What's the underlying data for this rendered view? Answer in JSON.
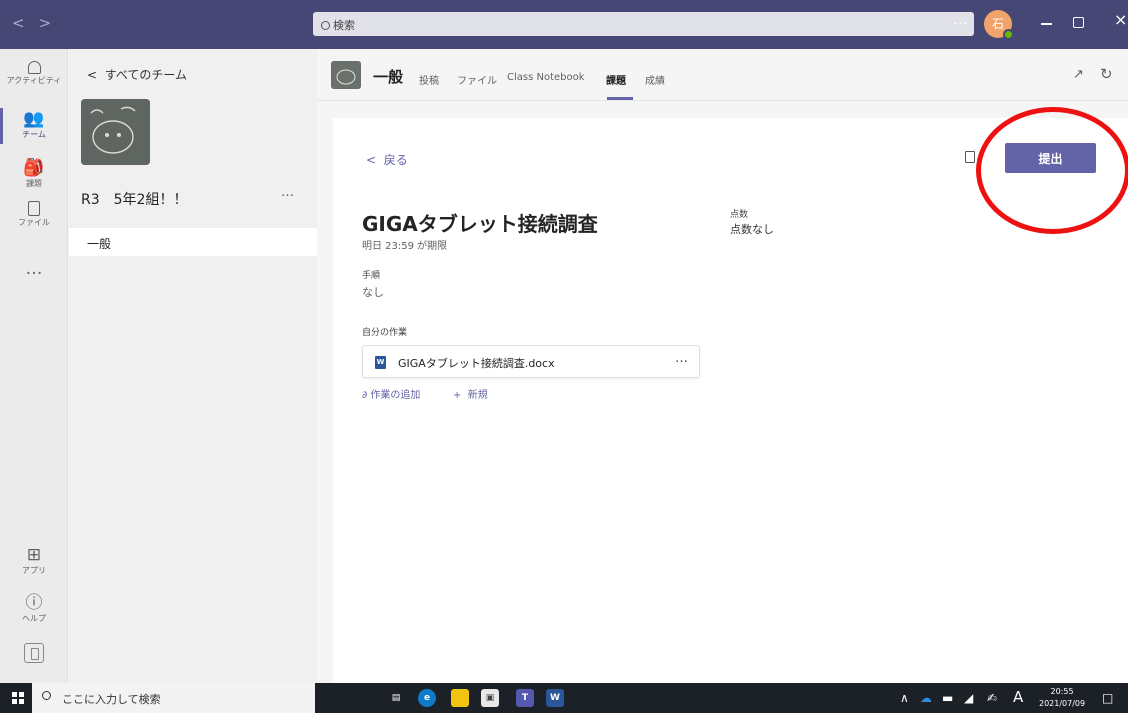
{
  "titlebar": {
    "nav_back": "<",
    "nav_forward": ">",
    "search_placeholder": "検索",
    "more": "…",
    "avatar_initial": "石",
    "minimize": "",
    "maximize": "",
    "close": "×"
  },
  "appbar": {
    "items": [
      {
        "label": "アクティビティ",
        "icon": "bell-icon"
      },
      {
        "label": "チーム",
        "icon": "teams-icon"
      },
      {
        "label": "課題",
        "icon": "assignments-icon"
      },
      {
        "label": "ファイル",
        "icon": "file-icon"
      },
      {
        "label": "…",
        "icon": "more-icon"
      },
      {
        "label": "アプリ",
        "icon": "apps-icon"
      },
      {
        "label": "ヘルプ",
        "icon": "help-icon"
      }
    ],
    "active_index": 1
  },
  "teampanel": {
    "all_teams": "すべてのチーム",
    "team_name": "R3　5年2組！！",
    "team_more": "…",
    "channels": [
      "一般"
    ]
  },
  "channel": {
    "title": "一般",
    "tabs": [
      "投稿",
      "ファイル",
      "Class Notebook",
      "課題",
      "成績"
    ],
    "active_tab": "課題"
  },
  "assignment": {
    "back_label": "戻る",
    "submit_label": "提出",
    "title": "GIGAタブレット接続調査",
    "due": "明日 23:59 が期限",
    "points_label": "点数",
    "points_value": "点数なし",
    "instructions_label": "手順",
    "instructions_value": "なし",
    "my_work_label": "自分の作業",
    "file_name": "GIGAタブレット接続調査.docx",
    "file_more": "…",
    "add_work": "作業の追加",
    "new_label": "新規"
  },
  "taskbar": {
    "search_placeholder": "ここに入力して検索",
    "time": "20:55",
    "date": "2021/07/09",
    "ime": "A"
  },
  "colors": {
    "titlebar": "#464775",
    "accent": "#6264a7",
    "annotation": "#ee1111",
    "taskbar": "#1c2128"
  }
}
